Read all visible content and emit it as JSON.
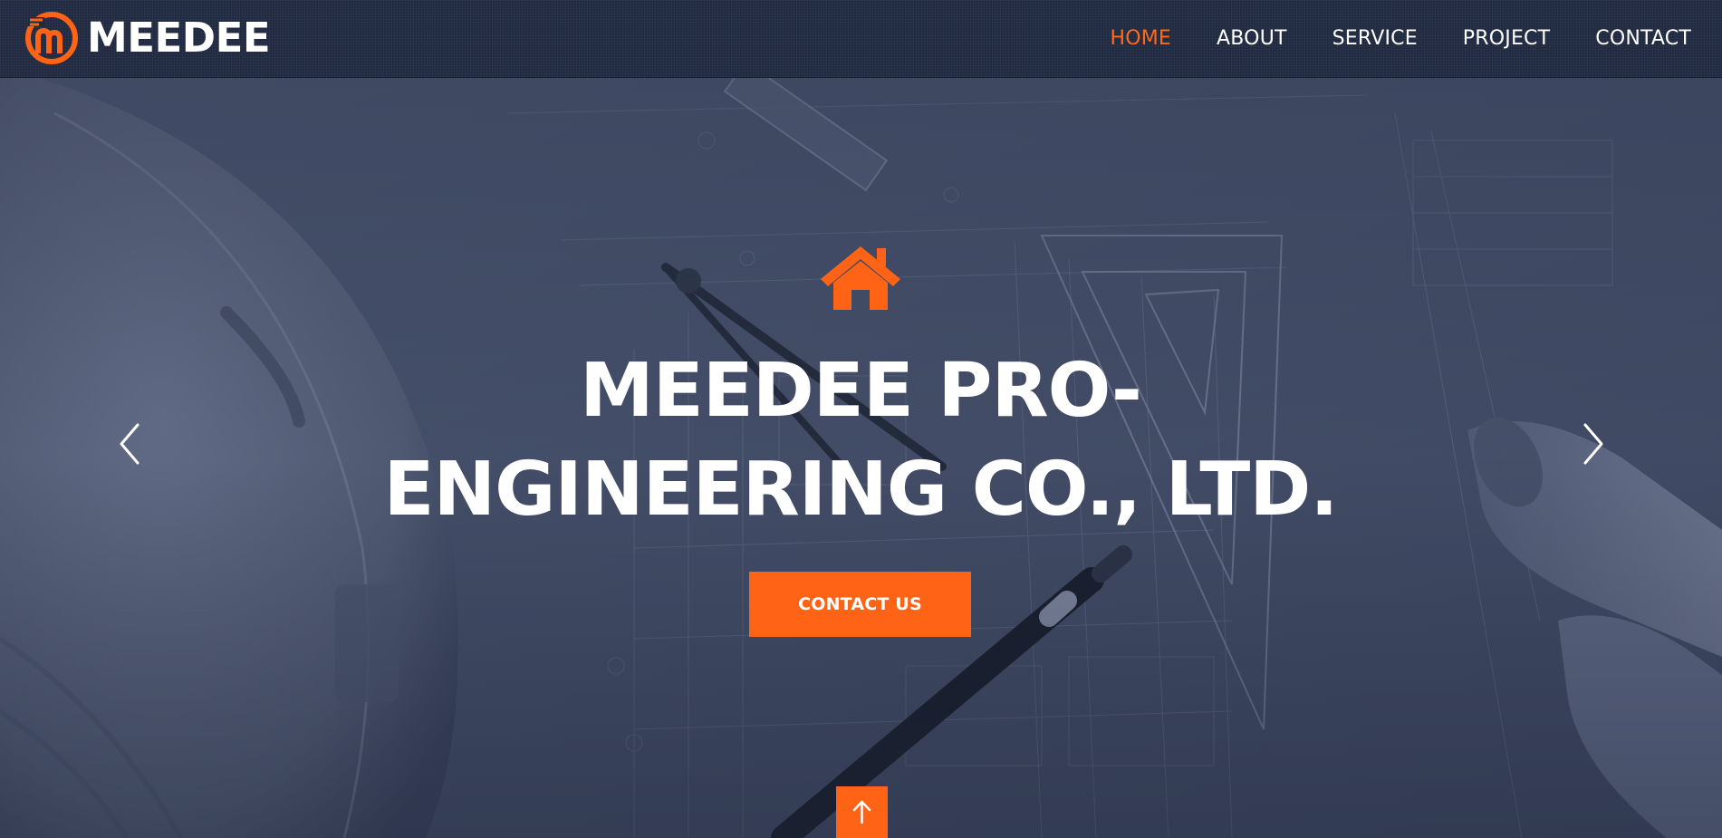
{
  "header": {
    "logo_text": "MEEDEE",
    "nav": [
      {
        "label": "HOME",
        "active": true
      },
      {
        "label": "ABOUT",
        "active": false
      },
      {
        "label": "SERVICE",
        "active": false
      },
      {
        "label": "PROJECT",
        "active": false
      },
      {
        "label": "CONTACT",
        "active": false
      }
    ]
  },
  "hero": {
    "icon": "house-icon",
    "title_line1": "MEEDEE PRO-",
    "title_line2": "ENGINEERING CO., LTD.",
    "cta_label": "CONTACT US",
    "prev_icon": "chevron-left-icon",
    "next_icon": "chevron-right-icon",
    "scroll_top_icon": "arrow-up-icon"
  },
  "colors": {
    "accent": "#ff6315",
    "header_bg": "#1f2940",
    "hero_tint": "#45506a",
    "text": "#ffffff"
  }
}
